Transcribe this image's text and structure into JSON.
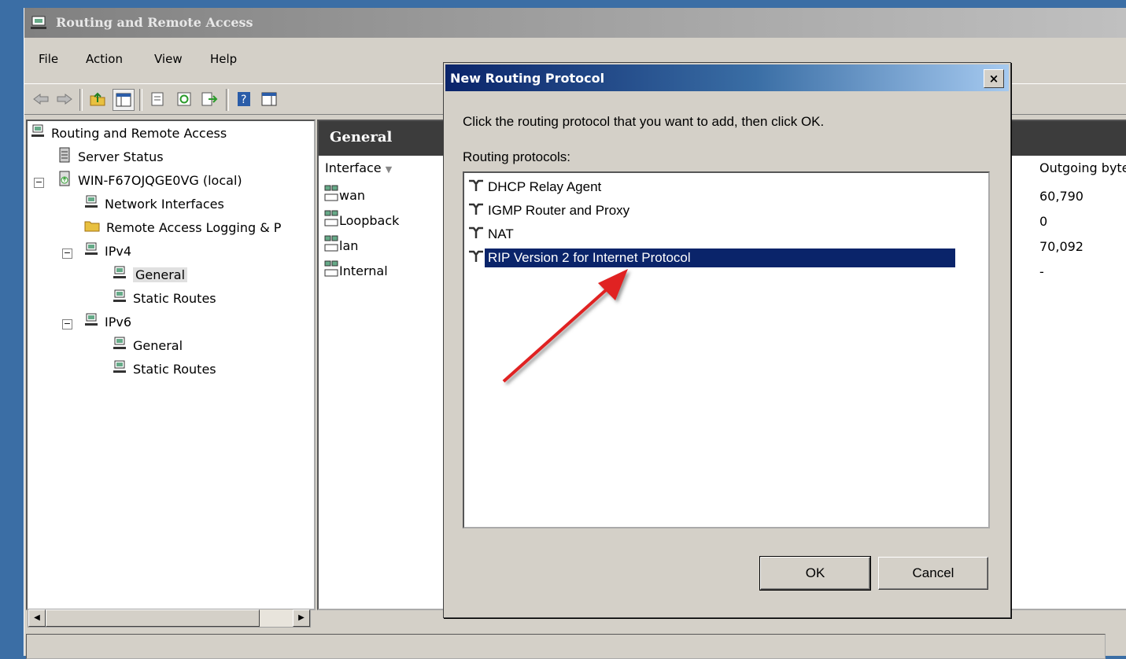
{
  "window": {
    "title": "Routing and Remote Access"
  },
  "menu": [
    "File",
    "Action",
    "View",
    "Help"
  ],
  "toolbar": {
    "icons": [
      "back-icon",
      "forward-icon",
      "up-folder-icon",
      "show-hide-tree-icon",
      "properties-icon",
      "refresh-icon",
      "export-list-icon",
      "help-icon",
      "action-pane-icon"
    ]
  },
  "tree": {
    "root": "Routing and Remote Access",
    "server_status": "Server Status",
    "server": "WIN-F67OJQGE0VG (local)",
    "network_interfaces": "Network Interfaces",
    "remote_access_logging": "Remote Access Logging & P",
    "ipv4": "IPv4",
    "ipv4_general": "General",
    "ipv4_static_routes": "Static Routes",
    "ipv6": "IPv6",
    "ipv6_general": "General",
    "ipv6_static_routes": "Static Routes"
  },
  "list": {
    "header": "General",
    "columns": {
      "interface": "Interface",
      "outgoing": "Outgoing byte"
    },
    "rows": [
      {
        "interface": "wan",
        "outgoing": "60,790"
      },
      {
        "interface": "Loopback",
        "outgoing": "0"
      },
      {
        "interface": "lan",
        "outgoing": "70,092"
      },
      {
        "interface": "Internal",
        "outgoing": "-"
      }
    ]
  },
  "dialog": {
    "title": "New Routing Protocol",
    "close": "×",
    "instruction": "Click the routing protocol that you want to add, then click OK.",
    "list_label": "Routing protocols:",
    "protocols": [
      "DHCP Relay Agent",
      "IGMP Router and Proxy",
      "NAT",
      "RIP Version 2 for Internet Protocol"
    ],
    "selected_index": 3,
    "ok_label": "OK",
    "cancel_label": "Cancel"
  },
  "colors": {
    "selection": "#0a246a",
    "annotation_arrow": "#e02020",
    "dialog_title_start": "#0a246a"
  }
}
